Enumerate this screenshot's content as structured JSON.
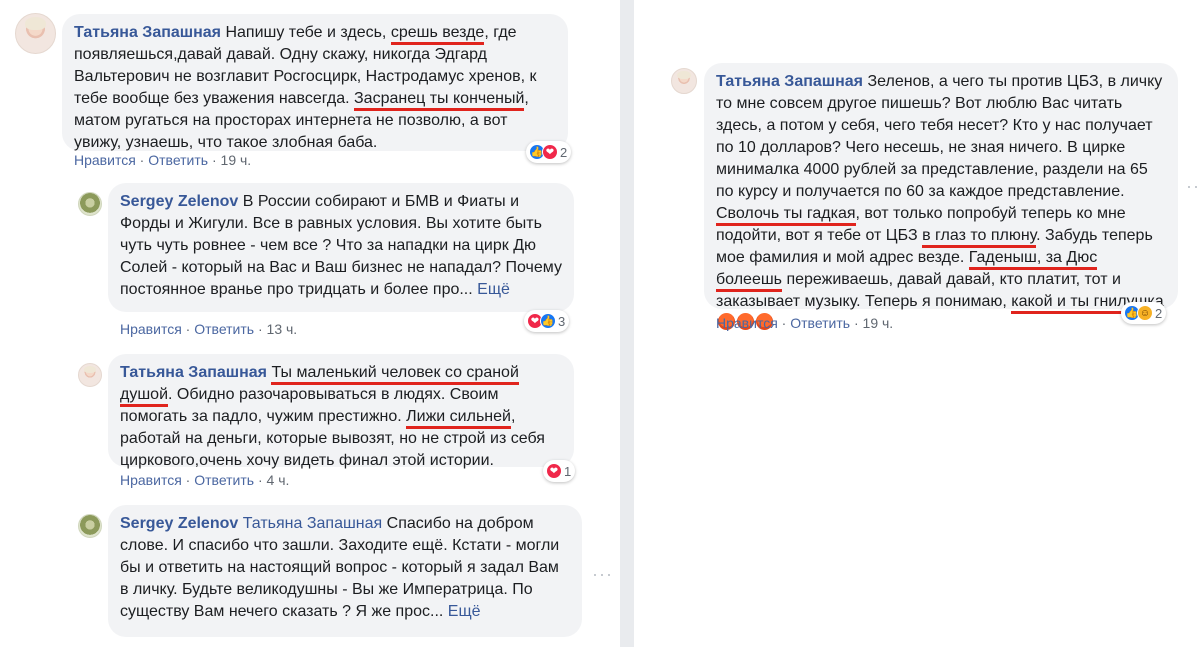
{
  "left": {
    "c1": {
      "author": "Татьяна Запашная",
      "t1": " Напишу тебе и здесь, ",
      "u1": "срешь везде",
      "t2": ", где появляешься,давай давай. Одну скажу, никогда Эдгард Вальтерович не возглавит Росгосцирк, Настродамус хренов, к тебе вообще без уважения навсегда. ",
      "u2": "Засранец ты конченый",
      "t3": ", матом ругаться на просторах интернета не позволю, а вот увижу, узнаешь, что такое злобная баба.",
      "like": "Нравится",
      "reply": "Ответить",
      "time": "19 ч.",
      "reactions": {
        "icons": [
          "like",
          "love"
        ],
        "count": "2"
      }
    },
    "c2": {
      "author": "Sergey Zelenov",
      "text": " В России собирают и БМВ и Фиаты и Форды и Жигули. Все в равных условия. Вы хотите быть чуть чуть ровнее - чем все ? Что за нападки на цирк Дю Солей - который на Вас и Ваш бизнес не нападал? Почему постоянное вранье про тридцать и более про... ",
      "more": "Ещё",
      "like": "Нравится",
      "reply": "Ответить",
      "time": "13 ч.",
      "reactions": {
        "icons": [
          "love",
          "like"
        ],
        "count": "3"
      }
    },
    "c3": {
      "author": "Татьяна Запашная",
      "u1": "Ты маленький человек со сраной душой",
      "t1": ". Обидно разочаровываться в людях. Своим помогать за падло, чужим престижно. ",
      "u2": "Лижи сильней",
      "t2": ", работай на деньги, которые вывозят, но не строй из себя циркового,очень хочу видеть финал этой истории.",
      "like": "Нравится",
      "reply": "Ответить",
      "time": "4 ч.",
      "reactions": {
        "icons": [
          "love"
        ],
        "count": "1"
      }
    },
    "c4": {
      "author": "Sergey Zelenov",
      "mention": " Татьяна Запашная",
      "text": " Спасибо на добром слове. И спасибо что зашли. Заходите ещё. Кстати - могли бы и ответить на настоящий вопрос - который я задал Вам в личку. Будьте великодушны - Вы же Императрица. По существу Вам нечего сказать ? Я же прос... ",
      "more": "Ещё"
    }
  },
  "right": {
    "c1": {
      "author": "Татьяна Запашная",
      "t1": " Зеленов, а чего ты против ЦБЗ, в личку то мне совсем другое пишешь? Вот люблю Вас читать здесь, а потом у себя, чего тебя несет? Кто у нас получает по 10 долларов? Чего несешь, не зная ничего. В цирке минималка 4000 рублей за представление, раздели на 65 по курсу и получается по 60 за каждое представление. ",
      "u1": "Сволочь ты гадкая",
      "t2": ", вот только попробуй теперь ко мне подойти, вот я тебе от ЦБЗ ",
      "u2": "в глаз то плюну",
      "t3": ". Забудь теперь мое фамилия и мой адрес везде. ",
      "u3": "Гаденыш, за Дюс болеешь",
      "t4": " переживаешь, давай давай, кто платит, тот и заказывает музыку. Теперь я понимаю, ",
      "u4": "какой и ты гнилушка",
      "like": "Нравится",
      "reply": "Ответить",
      "time": "19 ч.",
      "reactions": {
        "icons": [
          "like",
          "haha"
        ],
        "count": "2"
      }
    }
  },
  "icons": {
    "dots": "···",
    "angry_emoji": "angry-face-emoji"
  }
}
